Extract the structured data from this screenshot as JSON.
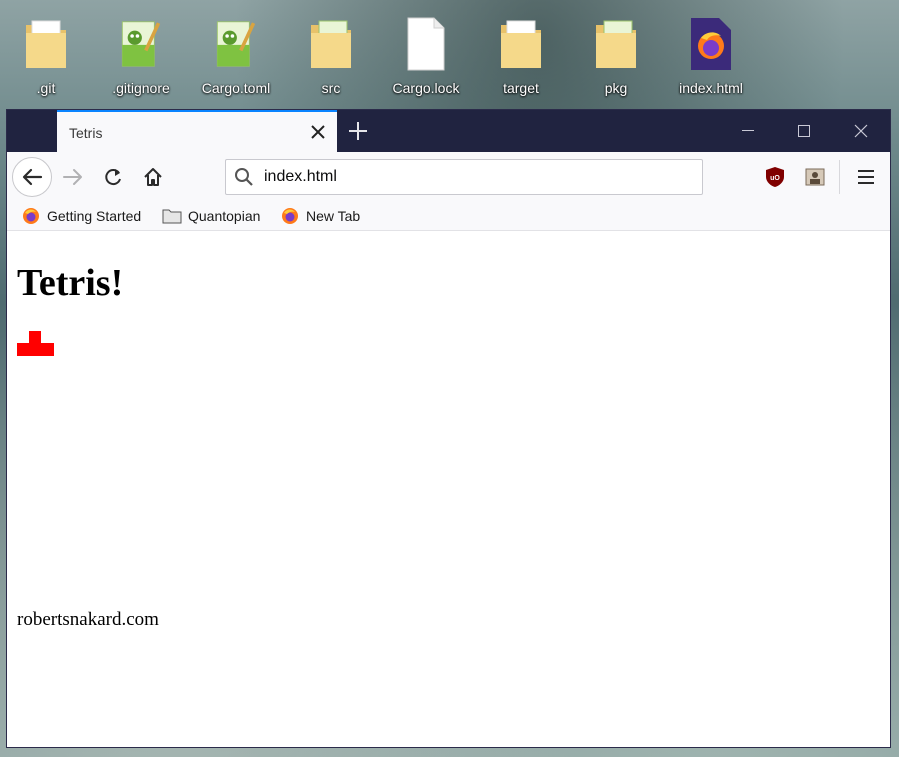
{
  "desktop": {
    "icons": [
      {
        "label": ".git",
        "type": "folder"
      },
      {
        "label": ".gitignore",
        "type": "notepadpp-file"
      },
      {
        "label": "Cargo.toml",
        "type": "notepadpp-file"
      },
      {
        "label": "src",
        "type": "folder"
      },
      {
        "label": "Cargo.lock",
        "type": "blank-file"
      },
      {
        "label": "target",
        "type": "folder"
      },
      {
        "label": "pkg",
        "type": "folder"
      },
      {
        "label": "index.html",
        "type": "firefox-file"
      }
    ]
  },
  "browser": {
    "tab_title": "Tetris",
    "url": "index.html",
    "bookmarks": [
      {
        "label": "Getting Started",
        "icon": "firefox-icon"
      },
      {
        "label": "Quantopian",
        "icon": "folder-icon"
      },
      {
        "label": "New Tab",
        "icon": "firefox-icon"
      }
    ],
    "accent_color": "#0a84ff",
    "titlebar_color": "#202340"
  },
  "page": {
    "heading": "Tetris!",
    "piece_color": "#ff0000",
    "footer": "robertsnakard.com"
  }
}
